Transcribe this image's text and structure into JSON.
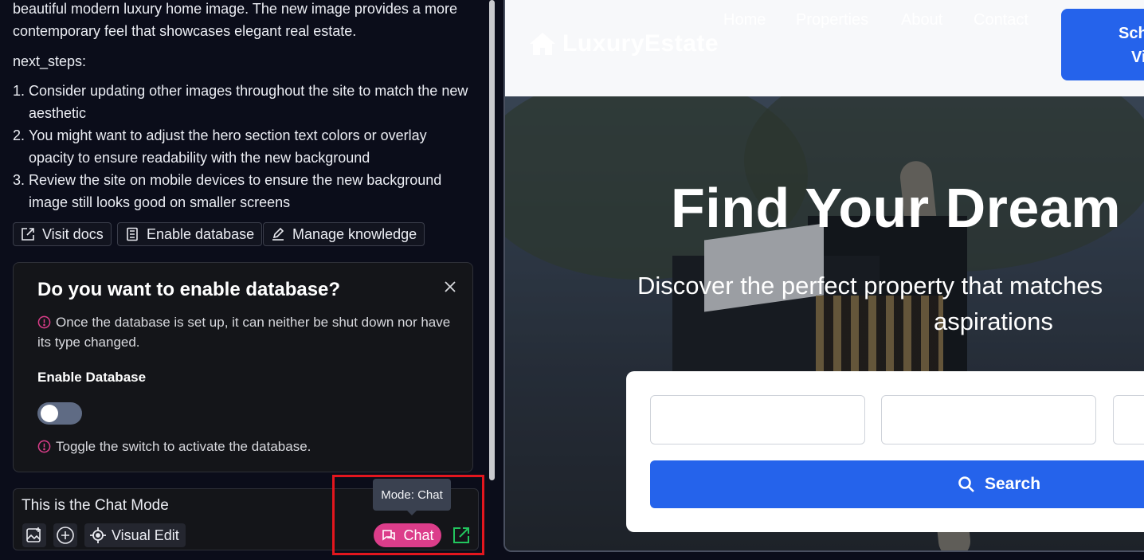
{
  "chat": {
    "paragraph": "beautiful modern luxury home image. The new image provides a more contemporary feel that showcases elegant real estate.",
    "next_steps_label": "next_steps:",
    "steps": [
      {
        "num": "1.",
        "text": "Consider updating other images throughout the site to match the new aesthetic"
      },
      {
        "num": "2.",
        "text": "You might want to adjust the hero section text colors or overlay opacity to ensure readability with the new background"
      },
      {
        "num": "3.",
        "text": "Review the site on mobile devices to ensure the new background image still looks good on smaller screens"
      }
    ],
    "actions": {
      "visit_docs": "Visit docs",
      "enable_database": "Enable database",
      "manage_knowledge": "Manage knowledge"
    }
  },
  "db_dialog": {
    "title": "Do you want to enable database?",
    "warning": "Once the database is set up, it can neither be shut down nor have its type changed.",
    "toggle_label": "Enable Database",
    "toggle_on": false,
    "hint": "Toggle the switch to activate the database."
  },
  "composer": {
    "text": "This is the Chat Mode",
    "visual_edit": "Visual Edit",
    "tooltip": "Mode: Chat",
    "mode_label": "Chat"
  },
  "colors": {
    "accent_pink": "#dc3d8a",
    "highlight_red": "#e3161e",
    "site_blue": "#2563eb",
    "external_green": "#22c55e"
  },
  "site": {
    "logo": "LuxuryEstate",
    "nav": [
      "Home",
      "Properties",
      "About",
      "Contact"
    ],
    "cta": [
      "Sch",
      "Vi"
    ],
    "hero_title": "Find Your Dream",
    "hero_sub_line1": "Discover the perfect property that matches",
    "hero_sub_line2": "aspirations",
    "search_label": "Search"
  }
}
